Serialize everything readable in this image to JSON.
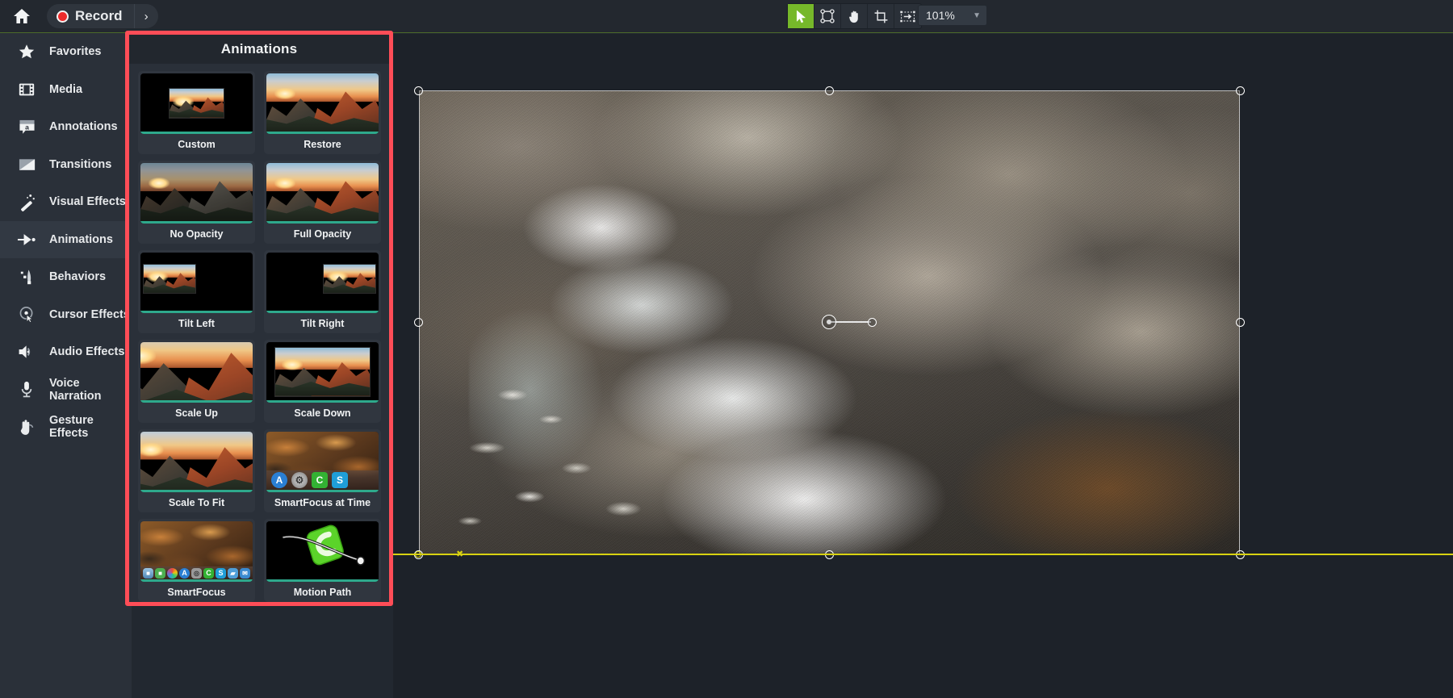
{
  "topbar": {
    "home_icon": "home-icon",
    "record_label": "Record",
    "record_caret": "›",
    "tools": [
      {
        "name": "select-tool",
        "icon": "cursor-arrow-icon",
        "active": true
      },
      {
        "name": "edit-points-tool",
        "icon": "anchor-points-icon",
        "active": false
      },
      {
        "name": "hand-tool",
        "icon": "hand-icon",
        "active": false
      },
      {
        "name": "crop-tool",
        "icon": "crop-icon",
        "active": false
      },
      {
        "name": "transform-tool",
        "icon": "transform-arrow-icon",
        "active": false
      }
    ],
    "zoom": {
      "value": "101%",
      "caret": "▼"
    }
  },
  "sidebar": {
    "items": [
      {
        "label": "Favorites",
        "icon": "star-icon",
        "selected": false
      },
      {
        "label": "Media",
        "icon": "filmstrip-icon",
        "selected": false
      },
      {
        "label": "Annotations",
        "icon": "speech-bubble-a-icon",
        "selected": false
      },
      {
        "label": "Transitions",
        "icon": "transition-icon",
        "selected": false
      },
      {
        "label": "Visual Effects",
        "icon": "magic-wand-icon",
        "selected": false
      },
      {
        "label": "Animations",
        "icon": "arrow-motion-icon",
        "selected": true
      },
      {
        "label": "Behaviors",
        "icon": "behaviors-icon",
        "selected": false
      },
      {
        "label": "Cursor Effects",
        "icon": "cursor-target-icon",
        "selected": false
      },
      {
        "label": "Audio Effects",
        "icon": "speaker-icon",
        "selected": false
      },
      {
        "label": "Voice Narration",
        "icon": "microphone-icon",
        "selected": false
      },
      {
        "label": "Gesture Effects",
        "icon": "hand-gesture-icon",
        "selected": false
      }
    ]
  },
  "panel": {
    "title": "Animations",
    "accent_color": "#2ea98c",
    "highlight_color": "#ff4d57",
    "items": [
      {
        "label": "Custom",
        "thumb": "mini-mountain-on-black"
      },
      {
        "label": "Restore",
        "thumb": "mountain-full"
      },
      {
        "label": "No Opacity",
        "thumb": "mountain-dim"
      },
      {
        "label": "Full Opacity",
        "thumb": "mountain-full"
      },
      {
        "label": "Tilt Left",
        "thumb": "mini-mountain-left"
      },
      {
        "label": "Tilt Right",
        "thumb": "mini-mountain-right"
      },
      {
        "label": "Scale Up",
        "thumb": "mountain-zoomed"
      },
      {
        "label": "Scale Down",
        "thumb": "mountain-inset"
      },
      {
        "label": "Scale To Fit",
        "thumb": "mountain-fit"
      },
      {
        "label": "SmartFocus at Time",
        "thumb": "desktop-dock-4"
      },
      {
        "label": "SmartFocus",
        "thumb": "desktop-dock-9"
      },
      {
        "label": "Motion Path",
        "thumb": "motion-path-art"
      }
    ],
    "dock_icons_at_time": [
      {
        "name": "app-store-icon",
        "glyph": "A",
        "bg": "#2a7fd4"
      },
      {
        "name": "system-prefs-icon",
        "glyph": "⚙",
        "bg": "#8c8c8c"
      },
      {
        "name": "camtasia-icon",
        "glyph": "C",
        "bg": "#33b233"
      },
      {
        "name": "snagit-icon",
        "glyph": "S",
        "bg": "#1f9ed8"
      }
    ],
    "dock_icons_full": [
      {
        "name": "finder-icon",
        "glyph": "■",
        "bg": "#6fa8d4"
      },
      {
        "name": "messages-icon",
        "glyph": "■",
        "bg": "#4caf50"
      },
      {
        "name": "photos-icon",
        "glyph": "✿",
        "bg": "#e8e8e8"
      },
      {
        "name": "app-store-icon",
        "glyph": "A",
        "bg": "#2a7fd4"
      },
      {
        "name": "preview-icon",
        "glyph": "◎",
        "bg": "#9a9a9a"
      },
      {
        "name": "camtasia-icon",
        "glyph": "C",
        "bg": "#33b233"
      },
      {
        "name": "snagit-icon",
        "glyph": "S",
        "bg": "#1f9ed8"
      },
      {
        "name": "folder-icon",
        "glyph": "▰",
        "bg": "#4f9fd8"
      },
      {
        "name": "mail-icon",
        "glyph": "✉",
        "bg": "#3a8ad0"
      }
    ]
  },
  "canvas": {
    "media_name": "river-rocks-photo",
    "guide_color": "#d8d211",
    "handles": [
      "top-left",
      "top-center",
      "top-right",
      "middle-left",
      "middle-right",
      "bottom-left",
      "bottom-center",
      "bottom-right"
    ],
    "anchor_name": "rotation-anchor"
  }
}
